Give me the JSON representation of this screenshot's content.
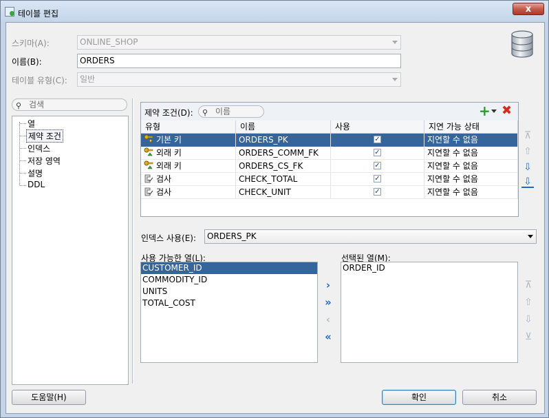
{
  "window": {
    "title": "테이블 편집",
    "close_label": "x"
  },
  "form": {
    "schema_label": "스키마(A):",
    "schema_value": "ONLINE_SHOP",
    "name_label": "이름(B):",
    "name_value": "ORDERS",
    "type_label": "테이블 유형(C):",
    "type_value": "일반"
  },
  "tree": {
    "search_placeholder": "검색",
    "items": [
      {
        "label": "열",
        "selected": false
      },
      {
        "label": "제약 조건",
        "selected": true
      },
      {
        "label": "인덱스",
        "selected": false
      },
      {
        "label": "저장 영역",
        "selected": false
      },
      {
        "label": "설명",
        "selected": false
      },
      {
        "label": "DDL",
        "selected": false
      }
    ]
  },
  "constraints": {
    "label": "제약 조건(D):",
    "search_placeholder": "이름",
    "columns": [
      "유형",
      "이름",
      "사용",
      "지연 가능 상태"
    ],
    "rows": [
      {
        "type": "기본 키",
        "icon": "primary-key-icon",
        "name": "ORDERS_PK",
        "enabled": true,
        "deferrable": "지연할 수 없음",
        "selected": true
      },
      {
        "type": "외래 키",
        "icon": "foreign-key-icon",
        "name": "ORDERS_COMM_FK",
        "enabled": true,
        "deferrable": "지연할 수 없음",
        "selected": false
      },
      {
        "type": "외래 키",
        "icon": "foreign-key-icon",
        "name": "ORDERS_CS_FK",
        "enabled": true,
        "deferrable": "지연할 수 없음",
        "selected": false
      },
      {
        "type": "검사",
        "icon": "check-constraint-icon",
        "name": "CHECK_TOTAL",
        "enabled": true,
        "deferrable": "지연할 수 없음",
        "selected": false
      },
      {
        "type": "검사",
        "icon": "check-constraint-icon",
        "name": "CHECK_UNIT",
        "enabled": true,
        "deferrable": "지연할 수 없음",
        "selected": false
      }
    ]
  },
  "index": {
    "label": "인덱스 사용(E):",
    "value": "ORDERS_PK"
  },
  "available": {
    "label": "사용 가능한 열(L):",
    "items": [
      "CUSTOMER_ID",
      "COMMODITY_ID",
      "UNITS",
      "TOTAL_COST"
    ],
    "selected_index": 0
  },
  "selected_cols": {
    "label": "선택된 열(M):",
    "items": [
      "ORDER_ID"
    ]
  },
  "buttons": {
    "help": "도움말(H)",
    "ok": "확인",
    "cancel": "취소"
  },
  "colors": {
    "selection": "#35659a",
    "add": "#2a9a2a",
    "delete": "#d52b1e",
    "arrow": "#1f68c9"
  }
}
